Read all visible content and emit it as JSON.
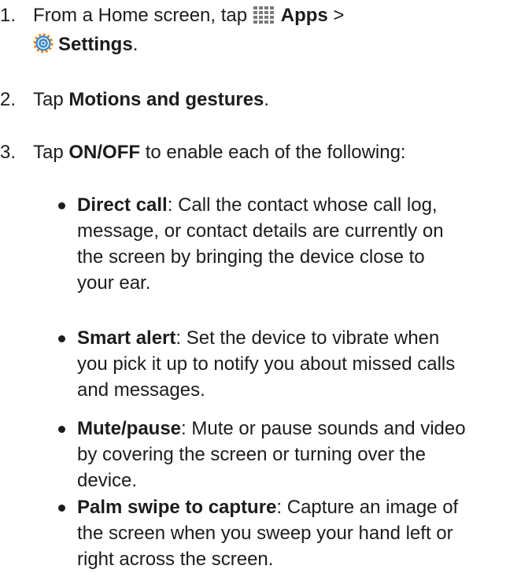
{
  "steps": [
    {
      "number": "1.",
      "pre": "From a Home screen, tap ",
      "apps_icon": "apps-grid-icon",
      "apps_label": "Apps",
      "sep": " >",
      "settings_icon": "settings-gear-icon",
      "settings_label": "Settings",
      "end": "."
    },
    {
      "number": "2.",
      "pre": "Tap ",
      "bold": "Motions and gestures",
      "end": "."
    },
    {
      "number": "3.",
      "pre": "Tap ",
      "bold": "ON/OFF",
      "post": " to enable each of the following:"
    }
  ],
  "bullets": [
    {
      "term": "Direct call",
      "lines": [
        ": Call the contact whose call log,",
        "message, or contact details are currently on",
        "the screen by bringing the device close to",
        "your ear."
      ]
    },
    {
      "term": "Smart alert",
      "lines": [
        ": Set the device to vibrate when",
        "you pick it up to notify you about missed calls",
        "and messages."
      ]
    },
    {
      "term": "Mute/pause",
      "lines": [
        ": Mute or pause sounds and video",
        "by covering the screen or turning over the",
        "device."
      ]
    },
    {
      "term": "Palm swipe to capture",
      "lines": [
        ": Capture an image of",
        "the screen when you sweep your hand left or",
        "right across the screen."
      ]
    }
  ],
  "colors": {
    "text": "#1c1c1c",
    "apps_icon": "#7a7a7a",
    "settings_icon_blue": "#2f7ec4",
    "settings_icon_orange": "#e48a1c"
  }
}
